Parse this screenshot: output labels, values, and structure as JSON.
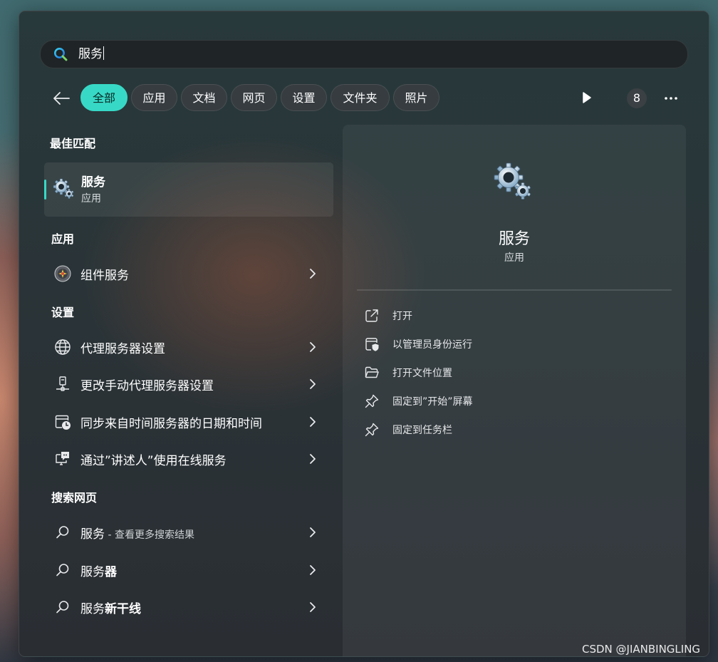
{
  "search": {
    "query": "服务"
  },
  "filters": {
    "chips": [
      {
        "label": "全部",
        "active": true
      },
      {
        "label": "应用"
      },
      {
        "label": "文档"
      },
      {
        "label": "网页"
      },
      {
        "label": "设置"
      },
      {
        "label": "文件夹"
      },
      {
        "label": "照片"
      }
    ],
    "count": "8"
  },
  "best_match": {
    "heading": "最佳匹配",
    "title": "服务",
    "subtitle": "应用",
    "icon": "gears-icon"
  },
  "apps": {
    "heading": "应用",
    "items": [
      {
        "label": "组件服务",
        "icon": "component-services-icon"
      }
    ]
  },
  "settings": {
    "heading": "设置",
    "items": [
      {
        "label": "代理服务器设置",
        "icon": "globe-icon"
      },
      {
        "label": "更改手动代理服务器设置",
        "icon": "network-computer-icon"
      },
      {
        "label": "同步来自时间服务器的日期和时间",
        "icon": "calendar-clock-icon"
      },
      {
        "label": "通过”讲述人”使用在线服务",
        "icon": "narrator-icon"
      }
    ]
  },
  "web": {
    "heading": "搜索网页",
    "items": [
      {
        "label": "服务",
        "suffix": " - 查看更多搜索结果",
        "icon": "search-icon"
      },
      {
        "prefix": "服务",
        "bold": "器",
        "icon": "search-icon"
      },
      {
        "prefix": "服务",
        "bold": "新干线",
        "icon": "search-icon"
      }
    ]
  },
  "preview": {
    "title": "服务",
    "subtitle": "应用",
    "actions": [
      {
        "label": "打开",
        "icon": "open-external-icon"
      },
      {
        "label": "以管理员身份运行",
        "icon": "shield-run-admin-icon"
      },
      {
        "label": "打开文件位置",
        "icon": "folder-icon"
      },
      {
        "label": "固定到”开始”屏幕",
        "icon": "pin-icon"
      },
      {
        "label": "固定到任务栏",
        "icon": "pin-icon"
      }
    ]
  },
  "watermark": "CSDN @JIANBINGLING",
  "colors": {
    "accent": "#37d9c6",
    "panel": "#2a3337"
  }
}
